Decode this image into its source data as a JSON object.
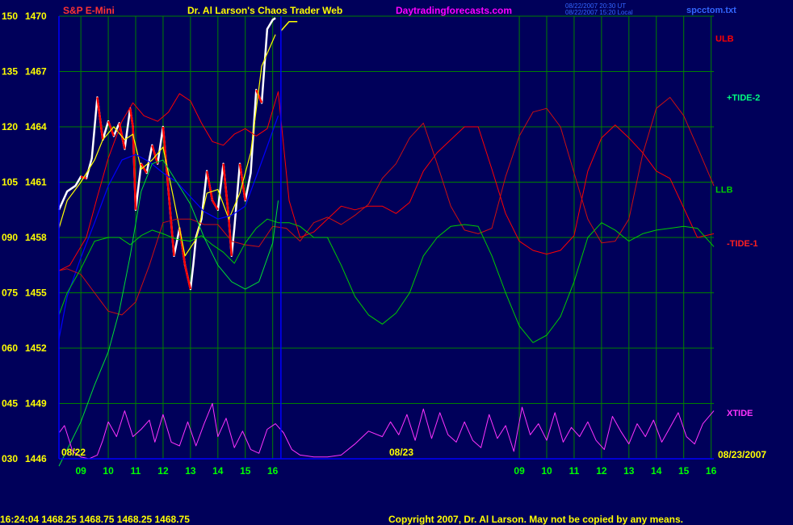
{
  "header": {
    "instrument": "S&P E-Mini",
    "site_title": "Dr. Al Larson's Chaos Trader Web",
    "site_url": "Daytradingforecasts.com",
    "stamp_line1": "08/22/2007 20:30 UT",
    "stamp_line2": "08/22/2007 15:20 Local",
    "file_name": "spcctom.txt"
  },
  "footer": {
    "quote": "16:24:04  1468.25  1468.75  1468.25  1468.75",
    "copyright": "Copyright 2007, Dr. Al Larson. May not be copied by any means."
  },
  "date_labels": {
    "start": "08/22",
    "mid": "08/23",
    "end": "08/23/2007"
  },
  "colors": {
    "background": "#00005a",
    "grid": "#008000",
    "axis": "#0000ff",
    "price_up": "#ffffff",
    "price_down": "#ff0000",
    "average": "#ffff00",
    "ulb": "#ff0000",
    "llb": "#00cc00",
    "tide2": "#00ff80",
    "tide1": "#ff2020",
    "xtide": "#ff33ff",
    "blue_line": "#0000ff",
    "title_magenta": "#ff00ff",
    "label_yellow": "#ffff00"
  },
  "chart_data": {
    "type": "line",
    "title": "S&P E-Mini",
    "y_axis": {
      "labels": [
        {
          "index": "150",
          "price": "1470"
        },
        {
          "index": "135",
          "price": "1467"
        },
        {
          "index": "120",
          "price": "1464"
        },
        {
          "index": "105",
          "price": "1461"
        },
        {
          "index": "090",
          "price": "1458"
        },
        {
          "index": "075",
          "price": "1455"
        },
        {
          "index": "060",
          "price": "1452"
        },
        {
          "index": "045",
          "price": "1449"
        },
        {
          "index": "030",
          "price": "1446"
        }
      ],
      "price_range": [
        1446,
        1470
      ]
    },
    "x_axis": {
      "hour_labels": [
        "09",
        "10",
        "11",
        "12",
        "13",
        "14",
        "15",
        "16",
        "09",
        "10",
        "11",
        "12",
        "13",
        "14",
        "15",
        "16"
      ],
      "range_hours": [
        8.2,
        32.1
      ],
      "divider_at": 16.3
    },
    "legend_labels": [
      {
        "name": "ULB",
        "color": "#ff0000"
      },
      {
        "name": "+TIDE-2",
        "color": "#00ff80"
      },
      {
        "name": "LLB",
        "color": "#00cc00"
      },
      {
        "name": "-TIDE-1",
        "color": "#ff2020"
      },
      {
        "name": "XTIDE",
        "color": "#ff33ff"
      }
    ],
    "series": [
      {
        "id": "price",
        "values_x": [
          8.2,
          8.5,
          8.8,
          9.0,
          9.2,
          9.4,
          9.6,
          9.8,
          10.0,
          10.2,
          10.4,
          10.6,
          10.8,
          10.9,
          11.0,
          11.2,
          11.4,
          11.6,
          11.8,
          12.0,
          12.2,
          12.4,
          12.6,
          12.8,
          13.0,
          13.1,
          13.2,
          13.4,
          13.6,
          13.8,
          14.0,
          14.2,
          14.4,
          14.5,
          14.6,
          14.8,
          15.0,
          15.2,
          15.4,
          15.6,
          15.8,
          16.0,
          16.1
        ],
        "values_y": [
          1459.5,
          1460.5,
          1460.8,
          1461.3,
          1461.2,
          1462.3,
          1465.6,
          1463.3,
          1464.3,
          1463.5,
          1464.2,
          1462.8,
          1465.0,
          1464.0,
          1459.5,
          1462.0,
          1461.5,
          1463.0,
          1462.0,
          1464.0,
          1460.5,
          1457.0,
          1458.5,
          1456.5,
          1455.2,
          1456.5,
          1458.0,
          1459.0,
          1461.6,
          1460.0,
          1459.5,
          1462.0,
          1459.0,
          1457.0,
          1458.5,
          1462.0,
          1460.0,
          1461.5,
          1466.0,
          1465.3,
          1469.3,
          1469.8,
          1469.9
        ]
      },
      {
        "id": "average",
        "values_x": [
          8.2,
          8.5,
          9.0,
          9.5,
          9.8,
          10.2,
          10.6,
          10.9,
          11.2,
          11.6,
          12.0,
          12.4,
          12.8,
          13.2,
          13.6,
          14.0,
          14.4,
          14.8,
          15.2,
          15.6,
          16.1
        ],
        "values_y": [
          1458.5,
          1460.0,
          1461.0,
          1462.2,
          1463.3,
          1464.0,
          1463.3,
          1463.6,
          1461.7,
          1462.2,
          1462.9,
          1460.0,
          1457.0,
          1457.9,
          1460.4,
          1460.6,
          1459.0,
          1460.4,
          1462.6,
          1467.3,
          1469.0
        ]
      },
      {
        "id": "blue",
        "values_x": [
          8.2,
          8.5,
          9.0,
          9.5,
          10.0,
          10.5,
          11.0,
          11.5,
          12.0,
          12.5,
          13.0,
          13.5,
          14.0,
          14.5,
          15.0,
          15.5,
          16.2
        ],
        "values_y": [
          1452.5,
          1454.8,
          1456.9,
          1458.8,
          1460.8,
          1462.2,
          1462.5,
          1462.1,
          1461.5,
          1461.0,
          1460.2,
          1459.4,
          1459.0,
          1459.2,
          1459.7,
          1461.7,
          1464.6
        ]
      },
      {
        "id": "ulb",
        "values_x": [
          8.2,
          8.6,
          9.2,
          9.6,
          10.0,
          10.5,
          10.9,
          11.3,
          11.8,
          12.2,
          12.6,
          13.0,
          13.4,
          13.8,
          14.2,
          14.6,
          15.0,
          15.4,
          15.8,
          16.2,
          16.6,
          17.0,
          17.5,
          18.0,
          18.5,
          19.0,
          19.5,
          20.0,
          20.5,
          21.0,
          21.5,
          22.0,
          22.5,
          23.0,
          23.5,
          24.0,
          24.5,
          25.0,
          25.5,
          26.0,
          26.5,
          27.0,
          27.5,
          28.0,
          28.5,
          29.0,
          29.5,
          30.0,
          30.5,
          31.0,
          31.5,
          32.1
        ],
        "values_y": [
          1456.2,
          1456.5,
          1458.0,
          1460.2,
          1462.3,
          1464.3,
          1465.3,
          1464.6,
          1464.3,
          1464.8,
          1465.8,
          1465.4,
          1464.2,
          1463.2,
          1463.0,
          1463.6,
          1463.9,
          1463.5,
          1463.9,
          1465.9,
          1460.0,
          1458.0,
          1458.3,
          1459.0,
          1459.7,
          1459.5,
          1459.7,
          1459.7,
          1459.3,
          1459.9,
          1461.6,
          1462.6,
          1463.3,
          1464.0,
          1464.0,
          1461.7,
          1459.3,
          1457.8,
          1457.3,
          1457.1,
          1457.3,
          1458.1,
          1461.6,
          1463.4,
          1464.1,
          1463.4,
          1462.6,
          1461.6,
          1461.2,
          1459.6,
          1458.0,
          1458.2
        ]
      },
      {
        "id": "tide1",
        "values_x": [
          8.2,
          8.5,
          9.0,
          9.5,
          10.0,
          10.5,
          11.0,
          11.5,
          12.0,
          12.5,
          13.0,
          13.5,
          14.0,
          14.5,
          15.0,
          15.5,
          16.0,
          16.5,
          17.0,
          17.5,
          18.0,
          18.5,
          19.0,
          19.5,
          20.0,
          20.5,
          21.0,
          21.5,
          22.0,
          22.5,
          23.0,
          23.5,
          24.0,
          24.5,
          25.0,
          25.5,
          26.0,
          26.5,
          27.0,
          27.5,
          28.0,
          28.5,
          29.0,
          29.5,
          30.0,
          30.5,
          31.0,
          31.5,
          32.1
        ],
        "values_y": [
          1456.2,
          1456.3,
          1456.0,
          1455.0,
          1454.0,
          1453.8,
          1454.5,
          1456.5,
          1458.8,
          1459.0,
          1459.0,
          1458.7,
          1458.7,
          1457.8,
          1457.6,
          1457.5,
          1458.6,
          1458.5,
          1457.8,
          1458.8,
          1459.1,
          1458.7,
          1459.2,
          1459.8,
          1461.2,
          1462.0,
          1463.4,
          1464.2,
          1462.0,
          1459.7,
          1458.4,
          1458.2,
          1458.5,
          1461.3,
          1463.5,
          1464.8,
          1465.0,
          1464.0,
          1461.5,
          1459.0,
          1457.7,
          1457.8,
          1459.0,
          1462.5,
          1465.0,
          1465.6,
          1464.6,
          1462.9,
          1460.8
        ]
      },
      {
        "id": "llb",
        "values_x": [
          8.2,
          8.5,
          9.0,
          9.5,
          10.0,
          10.4,
          10.8,
          11.2,
          11.6,
          12.0,
          12.5,
          13.0,
          13.4,
          13.8,
          14.2,
          14.6,
          15.0,
          15.4,
          15.8,
          16.2,
          16.6,
          17.0,
          17.5,
          18.0,
          18.5,
          19.0,
          19.5,
          20.0,
          20.5,
          21.0,
          21.5,
          22.0,
          22.5,
          23.0,
          23.5,
          24.0,
          24.5,
          25.0,
          25.5,
          26.0,
          26.5,
          27.0,
          27.5,
          28.0,
          28.5,
          29.0,
          29.5,
          30.0,
          30.5,
          31.0,
          31.5,
          32.1
        ],
        "values_y": [
          1453.8,
          1455.0,
          1456.3,
          1457.8,
          1458.0,
          1458.0,
          1457.6,
          1458.1,
          1458.4,
          1458.2,
          1457.9,
          1457.8,
          1458.1,
          1457.6,
          1457.2,
          1456.6,
          1457.7,
          1458.5,
          1459.0,
          1458.8,
          1458.8,
          1458.6,
          1458.0,
          1458.0,
          1456.5,
          1454.8,
          1453.8,
          1453.3,
          1453.9,
          1455.0,
          1457.0,
          1458.0,
          1458.6,
          1458.7,
          1458.6,
          1457.0,
          1455.0,
          1453.2,
          1452.3,
          1452.7,
          1453.7,
          1455.6,
          1458.0,
          1458.8,
          1458.4,
          1457.8,
          1458.2,
          1458.4,
          1458.5,
          1458.6,
          1458.5,
          1457.5
        ]
      },
      {
        "id": "tide2",
        "values_x": [
          8.2,
          8.5,
          9.0,
          9.5,
          10.0,
          10.4,
          10.8,
          11.2,
          11.6,
          12.0,
          12.5,
          13.0,
          13.5,
          14.0,
          14.5,
          15.0,
          15.5,
          16.0,
          16.2
        ],
        "values_y": [
          1445.6,
          1446.5,
          1448.0,
          1450.0,
          1451.8,
          1454.0,
          1457.0,
          1460.5,
          1462.0,
          1462.2,
          1461.0,
          1459.8,
          1458.0,
          1456.5,
          1455.6,
          1455.2,
          1455.6,
          1457.7,
          1460.0
        ]
      },
      {
        "id": "xtide",
        "values_x": [
          8.2,
          8.4,
          8.7,
          9.0,
          9.3,
          9.6,
          9.8,
          10.0,
          10.3,
          10.6,
          10.9,
          11.2,
          11.5,
          11.7,
          12.0,
          12.3,
          12.6,
          12.9,
          13.2,
          13.5,
          13.8,
          14.0,
          14.3,
          14.6,
          14.9,
          15.2,
          15.5,
          15.8,
          16.1,
          16.4,
          16.7,
          17.0,
          17.5,
          18.0,
          18.5,
          19.0,
          19.5,
          20.0,
          20.3,
          20.6,
          20.9,
          21.2,
          21.5,
          21.8,
          22.1,
          22.4,
          22.7,
          23.0,
          23.3,
          23.6,
          23.9,
          24.2,
          24.5,
          24.8,
          25.1,
          25.4,
          25.7,
          26.0,
          26.3,
          26.6,
          26.9,
          27.2,
          27.5,
          27.8,
          28.1,
          28.4,
          28.7,
          29.0,
          29.3,
          29.6,
          29.9,
          30.2,
          30.5,
          30.8,
          31.1,
          31.4,
          31.7,
          32.1
        ],
        "values_y": [
          1447.4,
          1447.8,
          1446.4,
          1446.1,
          1446.0,
          1446.2,
          1447.0,
          1448.0,
          1447.2,
          1448.6,
          1447.2,
          1447.6,
          1448.1,
          1446.9,
          1448.4,
          1446.9,
          1446.7,
          1448.0,
          1446.7,
          1447.9,
          1449.0,
          1447.2,
          1448.2,
          1446.6,
          1447.5,
          1446.5,
          1446.3,
          1447.6,
          1447.9,
          1447.4,
          1446.5,
          1446.2,
          1446.1,
          1446.1,
          1446.2,
          1446.8,
          1447.5,
          1447.2,
          1448.0,
          1447.3,
          1448.4,
          1447.0,
          1448.7,
          1447.1,
          1448.5,
          1447.3,
          1446.9,
          1448.0,
          1447.0,
          1446.6,
          1448.4,
          1447.1,
          1447.8,
          1446.4,
          1448.8,
          1447.3,
          1447.9,
          1447.0,
          1448.5,
          1446.9,
          1447.7,
          1447.2,
          1448.0,
          1447.0,
          1446.5,
          1448.3,
          1447.5,
          1446.8,
          1447.9,
          1447.2,
          1448.1,
          1446.9,
          1447.7,
          1448.5,
          1447.2,
          1446.8,
          1447.9,
          1448.6
        ]
      },
      {
        "id": "forecast_hook",
        "values_x": [
          16.3,
          16.6,
          16.9
        ],
        "values_y": [
          1469.2,
          1469.7,
          1469.7
        ]
      }
    ]
  }
}
